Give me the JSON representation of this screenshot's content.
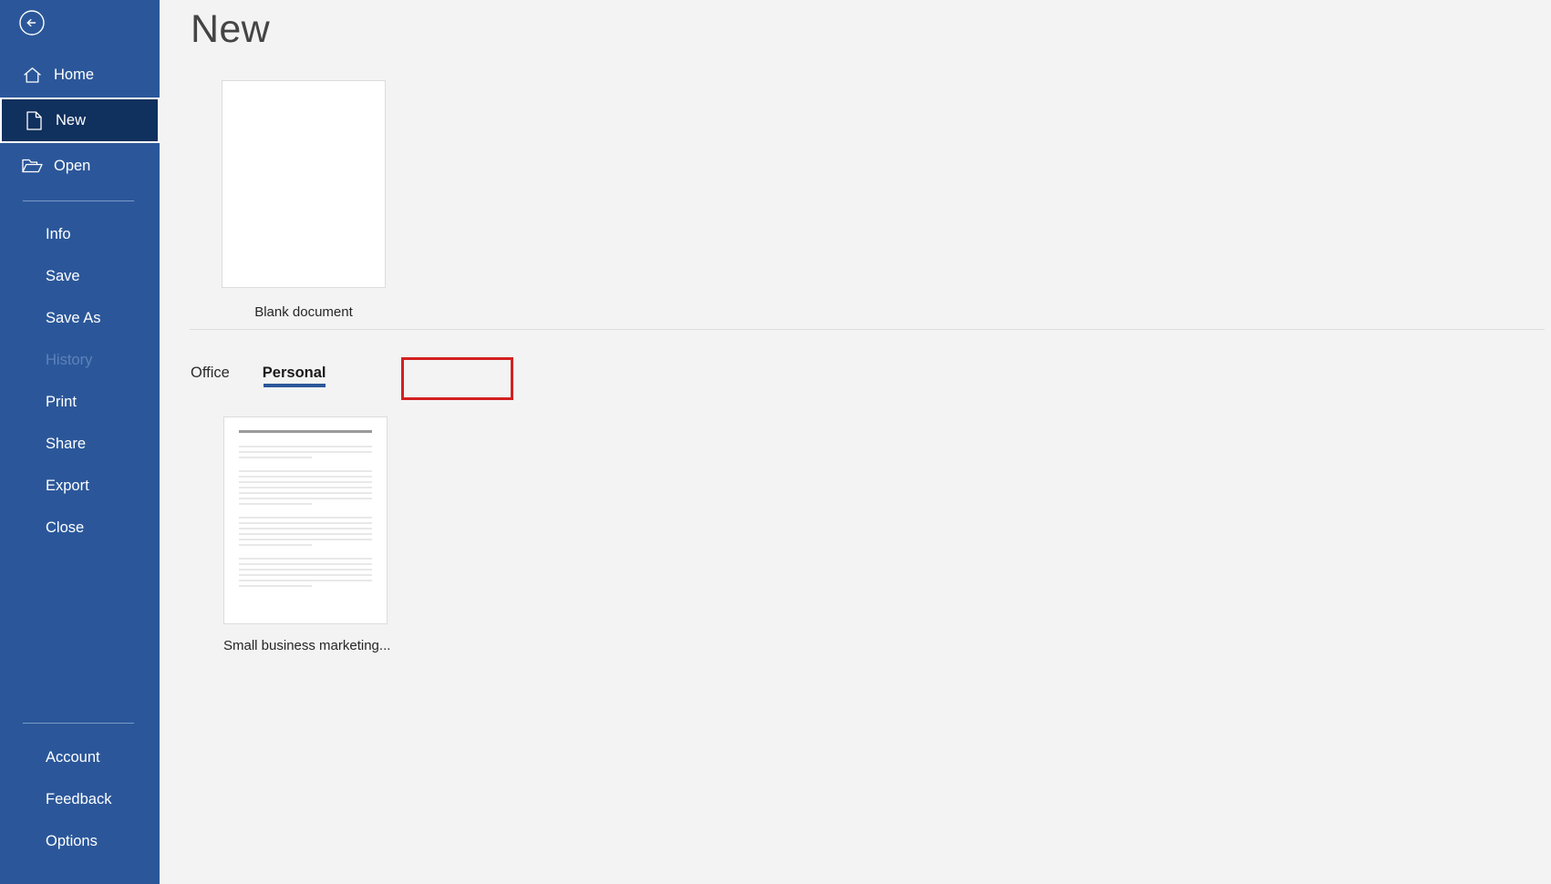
{
  "window": {
    "title": "New",
    "accent_color": "#2b579a",
    "sidebar_selected_color": "#10305e",
    "highlight_color": "#d32020"
  },
  "sidebar": {
    "back_button": "back-arrow-icon",
    "primary_items": [
      {
        "label": "Home",
        "icon": "home-icon",
        "selected": false
      },
      {
        "label": "New",
        "icon": "new-document-icon",
        "selected": true
      },
      {
        "label": "Open",
        "icon": "open-folder-icon",
        "selected": false
      }
    ],
    "secondary_items": [
      {
        "label": "Info",
        "disabled": false
      },
      {
        "label": "Save",
        "disabled": false
      },
      {
        "label": "Save As",
        "disabled": false
      },
      {
        "label": "History",
        "disabled": true
      },
      {
        "label": "Print",
        "disabled": false
      },
      {
        "label": "Share",
        "disabled": false
      },
      {
        "label": "Export",
        "disabled": false
      },
      {
        "label": "Close",
        "disabled": false
      }
    ],
    "bottom_items": [
      {
        "label": "Account"
      },
      {
        "label": "Feedback"
      },
      {
        "label": "Options"
      }
    ]
  },
  "main": {
    "heading": "New",
    "blank_document": {
      "caption": "Blank document"
    },
    "tabs": [
      {
        "label": "Office",
        "active": false
      },
      {
        "label": "Personal",
        "active": true
      }
    ],
    "templates": [
      {
        "caption": "Small business marketing..."
      }
    ]
  }
}
